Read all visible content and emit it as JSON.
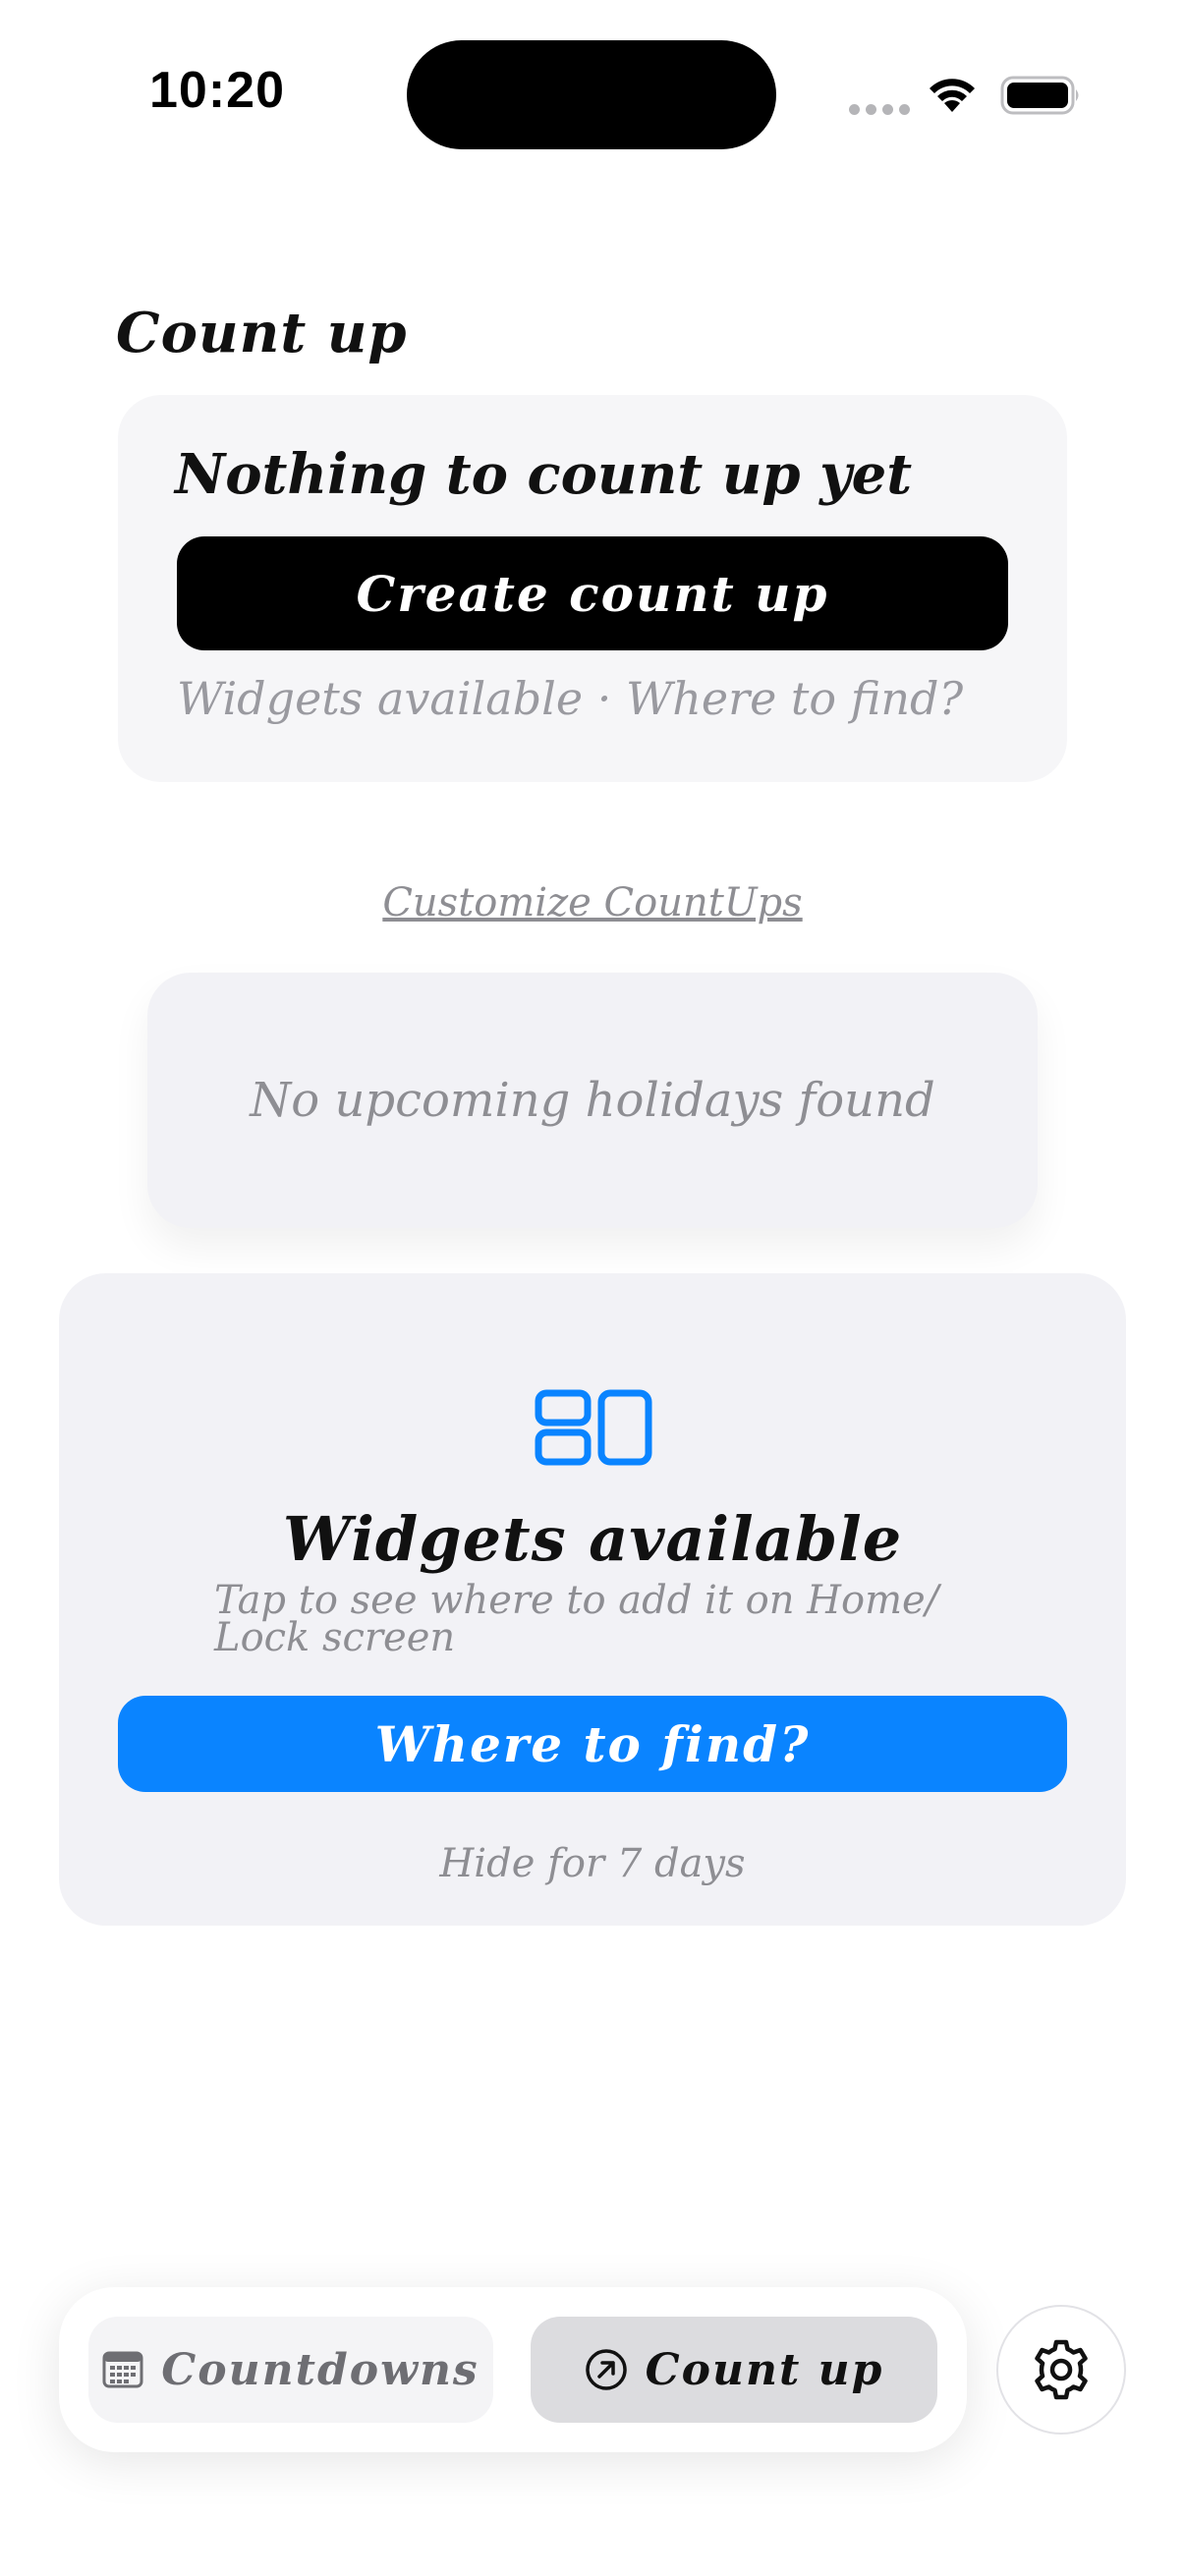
{
  "status_bar": {
    "time": "10:20"
  },
  "page": {
    "title": "Count up"
  },
  "empty_state": {
    "title": "Nothing to count up yet",
    "create_label": "Create count up",
    "hint": "Widgets available · Where to find?"
  },
  "customize": {
    "label": "Customize CountUps"
  },
  "holidays": {
    "message": "No upcoming holidays found"
  },
  "widget_promo": {
    "icon": "widgets-icon",
    "title": "Widgets available",
    "description": "Tap to see where to add it on Home/ Lock screen",
    "button_label": "Where to find?",
    "hide_label": "Hide for 7 days",
    "accent_color": "#0A84FF"
  },
  "tab_bar": {
    "tabs": [
      {
        "label": "Countdowns",
        "icon": "calendar-icon",
        "selected": false
      },
      {
        "label": "Count up",
        "icon": "arrow-up-right-circle-icon",
        "selected": true
      }
    ],
    "settings_icon": "gear-icon"
  }
}
